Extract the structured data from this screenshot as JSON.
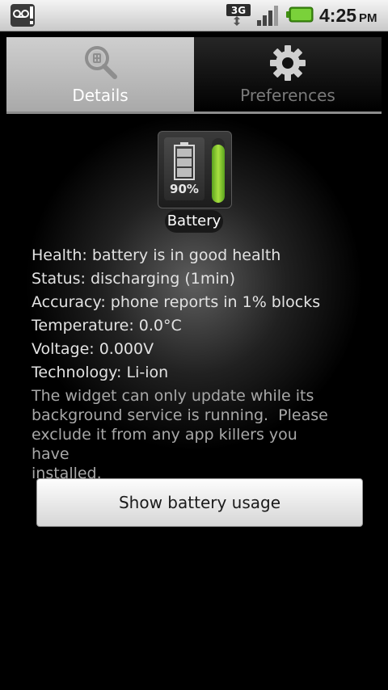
{
  "status_bar": {
    "notification_icon": "voicemail-alert-icon",
    "network_label": "3G",
    "signal_icon": "signal-strength-icon",
    "battery_icon": "battery-status-icon",
    "time": "4:25",
    "ampm": "PM"
  },
  "tabs": [
    {
      "label": "Details",
      "icon": "magnifier-icon",
      "selected": true
    },
    {
      "label": "Preferences",
      "icon": "gear-icon",
      "selected": false
    }
  ],
  "widget": {
    "percent_label": "90%",
    "level": 0.9,
    "label": "Battery",
    "level_color": "#7cc92a"
  },
  "info_lines": [
    "Health: battery is in good health",
    "Status: discharging (1min)",
    "Accuracy: phone reports in 1% blocks",
    "Temperature: 0.0°C",
    "Voltage: 0.000V",
    "Technology: Li-ion"
  ],
  "notice": "The widget can only update while its\nbackground service is running.  Please\nexclude it from any app killers you have\ninstalled.",
  "usage_button_label": "Show battery usage"
}
